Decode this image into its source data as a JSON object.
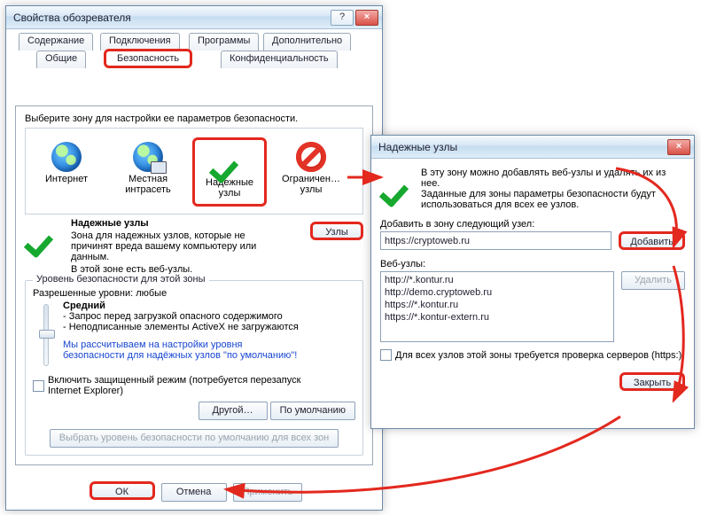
{
  "main": {
    "title": "Свойства обозревателя",
    "titlebar": {
      "help": "?",
      "close": "×"
    },
    "tabs": {
      "content": "Содержание",
      "connections": "Подключения",
      "programs": "Программы",
      "advanced": "Дополнительно",
      "general": "Общие",
      "security": "Безопасность",
      "privacy": "Конфиденциальность"
    },
    "zone_prompt": "Выберите зону для настройки ее параметров безопасности.",
    "zones": {
      "internet": "Интернет",
      "intranet": "Местная интрасеть",
      "trusted": "Надежные узлы",
      "restricted": "Ограничен… узлы"
    },
    "trusted_block": {
      "title": "Надежные узлы",
      "line1": "Зона для надежных узлов, которые не",
      "line2": "причинят вреда вашему компьютеру или",
      "line3": "данным.",
      "line4": "В этой зоне есть веб-узлы.",
      "sites_btn": "Узлы"
    },
    "level_group": {
      "legend": "Уровень безопасности для этой зоны",
      "allowed": "Разрешенные уровни: любые",
      "level_name": "Средний",
      "b1": "- Запрос перед загрузкой опасного содержимого",
      "b2": "- Неподписанные элементы ActiveX не загружаются",
      "note1": "Мы рассчитываем на настройки уровня",
      "note2": "безопасности для надёжных узлов \"по умолчанию\"!",
      "protected": "Включить защищенный режим (потребуется перезапуск Internet Explorer)",
      "custom_btn": "Другой…",
      "default_btn": "По умолчанию",
      "reset_btn": "Выбрать уровень безопасности по умолчанию для всех зон"
    },
    "buttons": {
      "ok": "ОК",
      "cancel": "Отмена",
      "apply": "Применить"
    }
  },
  "trusted": {
    "title": "Надежные узлы",
    "titlebar": {
      "close": "×"
    },
    "intro1": "В эту зону можно добавлять веб-узлы и удалять их из нее.",
    "intro2": "Заданные для зоны параметры безопасности будут",
    "intro3": "использоваться для всех ее узлов.",
    "add_label": "Добавить в зону следующий узел:",
    "add_value": "https://cryptoweb.ru",
    "add_btn": "Добавить",
    "list_label": "Веб-узлы:",
    "list": [
      "http://*.kontur.ru",
      "http://demo.cryptoweb.ru",
      "https://*.kontur.ru",
      "https://*.kontur-extern.ru"
    ],
    "remove_btn": "Удалить",
    "require_https": "Для всех узлов этой зоны требуется проверка серверов (https:)",
    "close_btn": "Закрыть"
  }
}
